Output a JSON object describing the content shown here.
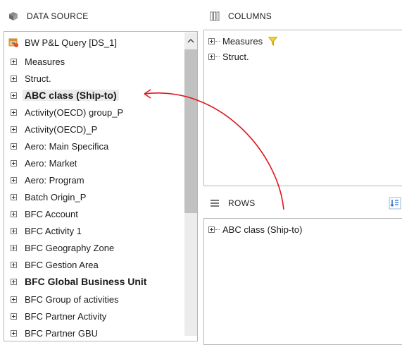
{
  "data_source": {
    "header": "DATA SOURCE",
    "root": "BW P&L Query [DS_1]",
    "items": [
      {
        "label": "Measures",
        "bold": false
      },
      {
        "label": "Struct.",
        "bold": false
      },
      {
        "label": "ABC class (Ship-to)",
        "bold": true,
        "selected": true
      },
      {
        "label": "Activity(OECD) group_P",
        "bold": false
      },
      {
        "label": "Activity(OECD)_P",
        "bold": false
      },
      {
        "label": "Aero: Main Specifica",
        "bold": false
      },
      {
        "label": "Aero: Market",
        "bold": false
      },
      {
        "label": "Aero: Program",
        "bold": false
      },
      {
        "label": "Batch Origin_P",
        "bold": false
      },
      {
        "label": "BFC Account",
        "bold": false
      },
      {
        "label": "BFC Activity 1",
        "bold": false
      },
      {
        "label": "BFC Geography Zone",
        "bold": false
      },
      {
        "label": "BFC Gestion Area",
        "bold": false
      },
      {
        "label": "BFC Global Business Unit",
        "bold": true
      },
      {
        "label": "BFC Group of activities",
        "bold": false
      },
      {
        "label": "BFC Partner Activity",
        "bold": false
      },
      {
        "label": "BFC Partner GBU",
        "bold": false
      }
    ]
  },
  "columns": {
    "header": "COLUMNS",
    "items": [
      {
        "label": "Measures"
      },
      {
        "label": "Struct."
      }
    ]
  },
  "rows": {
    "header": "ROWS",
    "items": [
      {
        "label": "ABC class (Ship-to)"
      }
    ]
  },
  "colors": {
    "annotation_arrow": "#e0161b",
    "filter_icon": "#e8c400",
    "accent_blue": "#1e6fd1"
  }
}
